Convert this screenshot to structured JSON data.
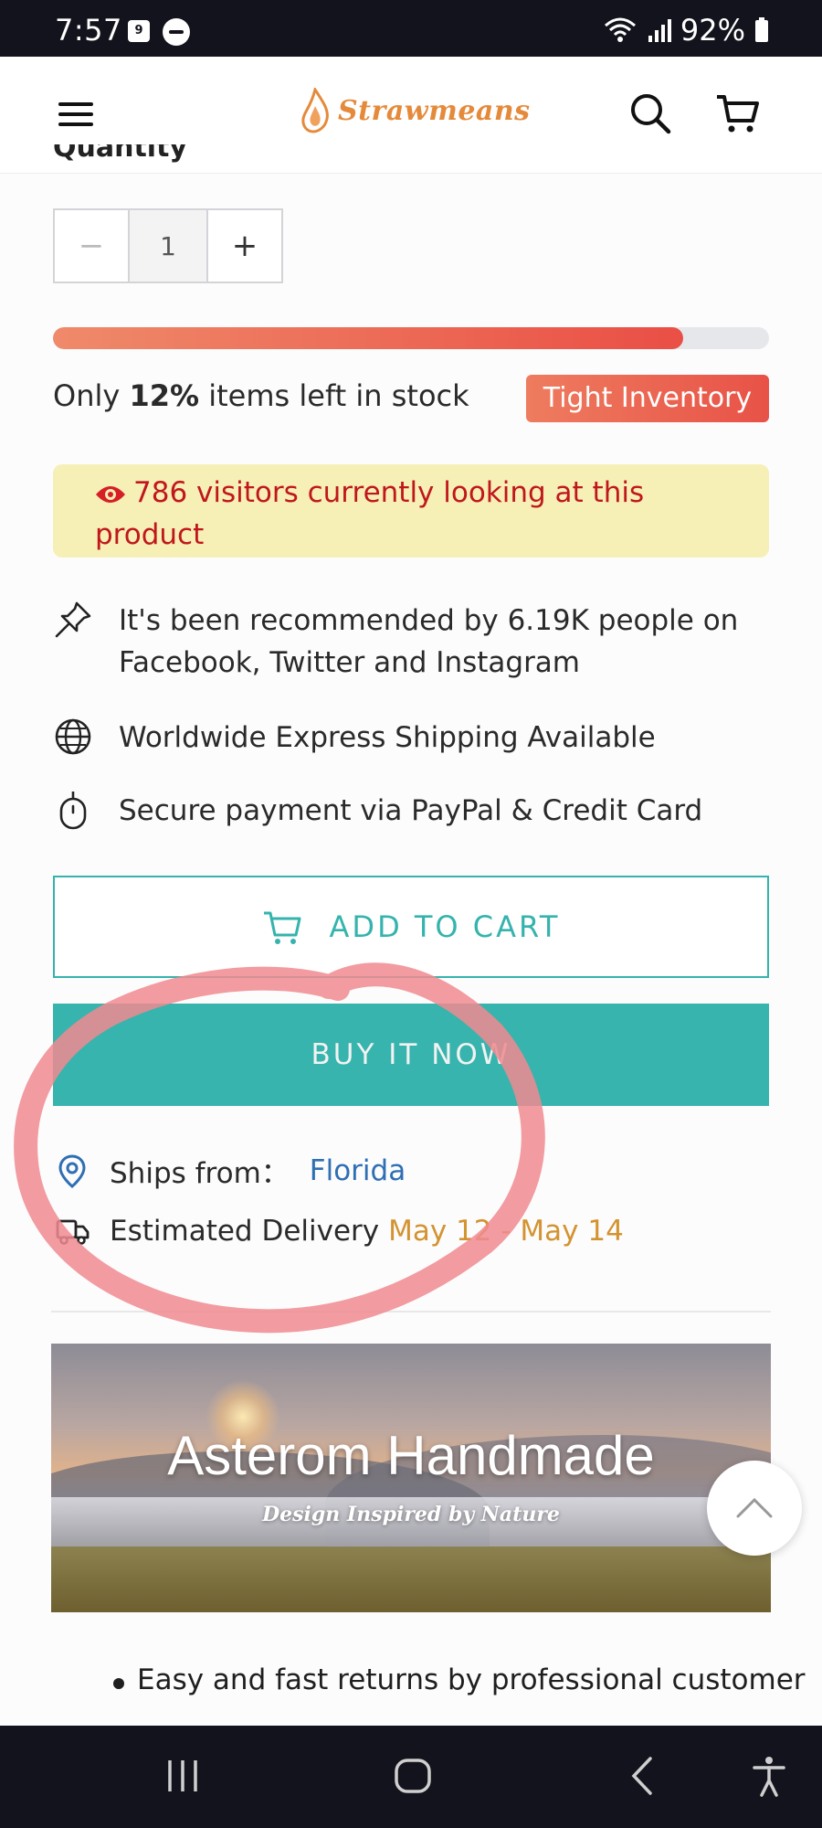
{
  "status_bar": {
    "time": "7:57",
    "calendar_badge": "9",
    "battery": "92%"
  },
  "header": {
    "brand": "Strawmeans",
    "brand_color": "#e58a3b"
  },
  "quantity": {
    "heading": "Quantity",
    "value": "1",
    "minus_label": "−",
    "plus_label": "+"
  },
  "stock": {
    "fill_fraction": 0.88,
    "prefix": "Only ",
    "percent": "12%",
    "suffix": " items left in stock",
    "badge": "Tight Inventory"
  },
  "visitors": {
    "text": "786 visitors currently looking at this product"
  },
  "features": [
    {
      "icon": "pin-icon",
      "text": "It's been recommended by 6.19K people on Facebook, Twitter and Instagram"
    },
    {
      "icon": "globe-icon",
      "text": "Worldwide Express Shipping Available"
    },
    {
      "icon": "secure-payment-icon",
      "text": "Secure payment via PayPal & Credit Card"
    }
  ],
  "buttons": {
    "add_to_cart": "ADD TO CART",
    "buy_now": "BUY IT NOW"
  },
  "shipping": {
    "ships_from_label": "Ships from：",
    "ships_from_value": "Florida",
    "delivery_label": "Estimated Delivery",
    "delivery_value": "May 12 - May 14"
  },
  "banner": {
    "title": "Asterom Handmade",
    "subtitle": "Design Inspired by Nature"
  },
  "bullets": [
    "Easy and fast returns by professional customer"
  ],
  "colors": {
    "accent": "#36b4ad",
    "alert": "#c0171d",
    "annotation": "#f0898f"
  }
}
